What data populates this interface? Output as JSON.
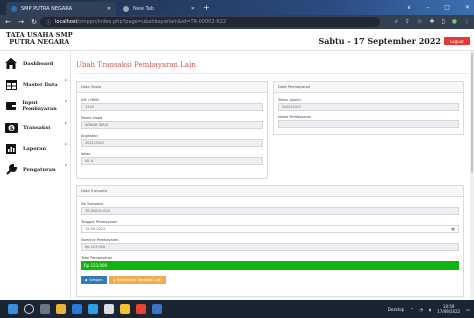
{
  "browser": {
    "tab1_title": "SMP PUTRA NEGARA",
    "tab2_title": "New Tab",
    "new_tab": "+",
    "url_host": "localhost",
    "url_path": "/smppn/index.php?page=ubahbayarlain&id=TR-00002-R22",
    "window_controls": [
      "∨",
      "–",
      "□",
      "✕"
    ]
  },
  "header": {
    "brand_line1": "TATA USAHA SMP",
    "brand_line2": "PUTRA NEGARA",
    "date": "Sabtu - 17 September 2022",
    "logout": "Logout"
  },
  "sidebar": {
    "items": [
      {
        "label": "Dashboard",
        "icon": "home-icon",
        "chevron": ""
      },
      {
        "label": "Master Data",
        "icon": "table-icon",
        "chevron": "‹"
      },
      {
        "label": "Input Pembayaran",
        "icon": "wallet-icon",
        "chevron": "‹"
      },
      {
        "label": "Transaksi",
        "icon": "money-icon",
        "chevron": "‹"
      },
      {
        "label": "Laporan",
        "icon": "report-icon",
        "chevron": "‹"
      },
      {
        "label": "Pengaturan",
        "icon": "wrench-icon",
        "chevron": "‹"
      }
    ]
  },
  "main": {
    "title": "Ubah Transaksi Pembayaran Lain",
    "siswa_panel": {
      "heading": "Data Siswa",
      "nis_label": "NIS / NISN",
      "nis_value": "1140",
      "nama_label": "Nama Siswa",
      "nama_value": "ARNUR IDRIS",
      "angkatan_label": "Angkatan",
      "angkatan_value": "2021/2022",
      "kelas_label": "Kelas",
      "kelas_value": "VII A"
    },
    "pembayaran_panel": {
      "heading": "Data Pembayaran",
      "tahun_label": "Tahun Ajaran",
      "tahun_value": "2021/2022",
      "nama_label": "Nama Pembayaran",
      "nama_value": ""
    },
    "transaksi_panel": {
      "heading": "Data Transaksi",
      "no_label": "No Transaksi",
      "no_value": "TR-00002-R22",
      "tgl_label": "Tanggal Pembayaran",
      "tgl_value": "12-09-2022",
      "nominal_label": "Nominal Pembayaran",
      "nominal_value": "Rp 123,000",
      "total_label": "Total Pembayaran",
      "total_value": "Rp 123,000",
      "btn_simpan": "Simpan",
      "btn_kembali": "Kembali ke Transaksi Lain"
    }
  },
  "taskbar": {
    "desktop": "Desktop",
    "time": "10:59",
    "date": "17/09/2022"
  },
  "colors": {
    "accent_red": "#d9534f",
    "total_green": "#10b510",
    "save_blue": "#337ab7",
    "back_orange": "#f0ad4e"
  }
}
